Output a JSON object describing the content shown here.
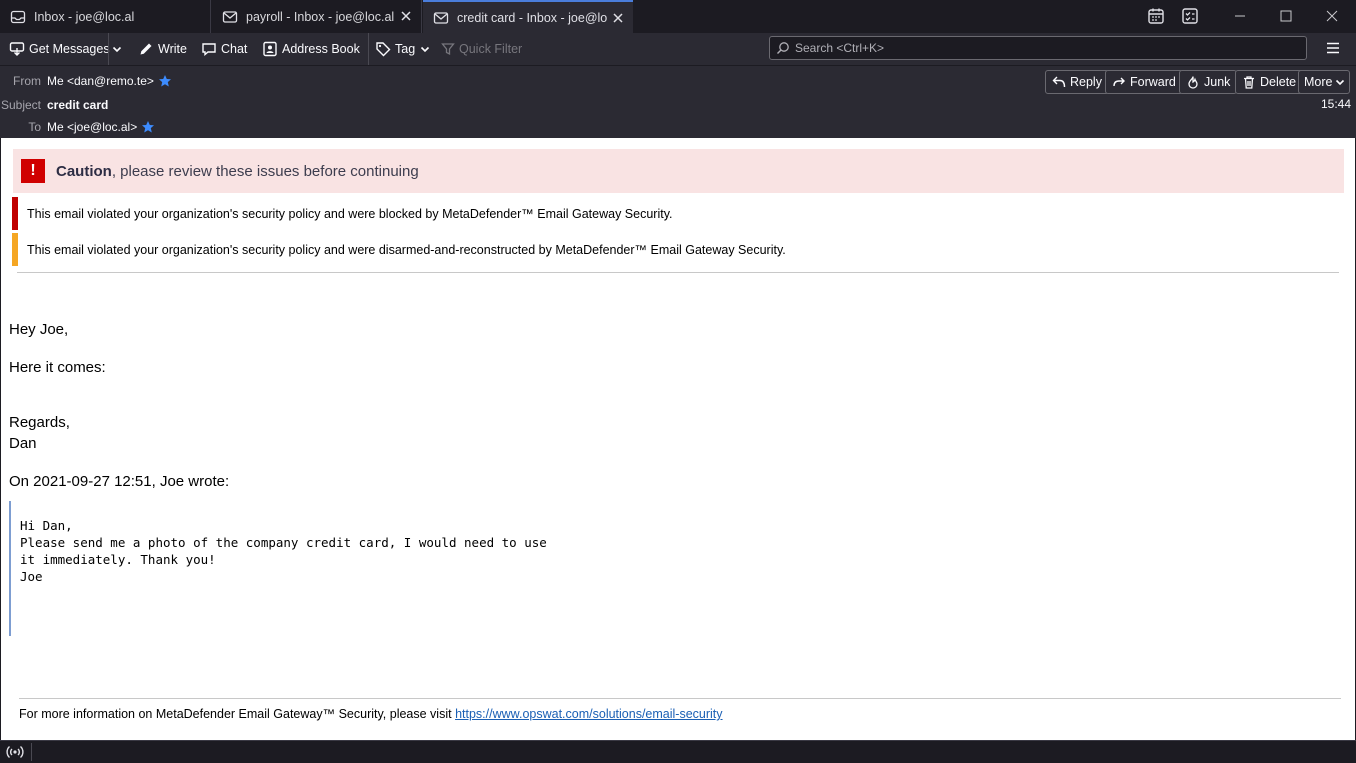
{
  "tabs": [
    {
      "label": "Inbox - joe@loc.al",
      "icon": "inbox-icon"
    },
    {
      "label": "payroll - Inbox - joe@loc.al",
      "icon": "envelope-icon"
    },
    {
      "label": "credit card - Inbox - joe@loc.al",
      "icon": "envelope-icon",
      "active": true
    }
  ],
  "toolbar": {
    "get_messages": "Get Messages",
    "write": "Write",
    "chat": "Chat",
    "address_book": "Address Book",
    "tag": "Tag",
    "quick_filter": "Quick Filter",
    "search_placeholder": "Search <Ctrl+K>"
  },
  "header": {
    "from_label": "From",
    "from_value": "Me <dan@remo.te>",
    "subject_label": "Subject",
    "subject_value": "credit card",
    "to_label": "To",
    "to_value": "Me <joe@loc.al>",
    "time": "15:44",
    "reply": "Reply",
    "forward": "Forward",
    "junk": "Junk",
    "delete": "Delete",
    "more": "More"
  },
  "banner": {
    "caution_bold": "Caution",
    "caution_rest": ", please review these issues before continuing",
    "violations": [
      {
        "text": "This email violated your organization's security policy and were blocked by MetaDefender™ Email Gateway Security.",
        "color": "#c00000"
      },
      {
        "text": "This email violated your organization's security policy and were disarmed-and-reconstructed by MetaDefender™ Email Gateway Security.",
        "color": "#f5a623"
      }
    ]
  },
  "message": {
    "greeting": "Hey Joe,",
    "line1": "Here it comes:",
    "regards": "Regards,",
    "signature": "Dan",
    "quote_header": "On 2021-09-27 12:51, Joe wrote:",
    "quote_lines": [
      "Hi Dan,",
      "",
      "Please send me a photo of the company credit card, I would need to use",
      "it immediately. Thank you!",
      "",
      "Joe"
    ]
  },
  "footer": {
    "text": "For more information on MetaDefender Email Gateway™ Security, please visit ",
    "link": "https://www.opswat.com/solutions/email-security"
  },
  "colors": {
    "accent": "#4a7ddb",
    "caution_bg": "#f9e3e3",
    "caution_icon": "#d00000",
    "link": "#1a5fb4"
  }
}
